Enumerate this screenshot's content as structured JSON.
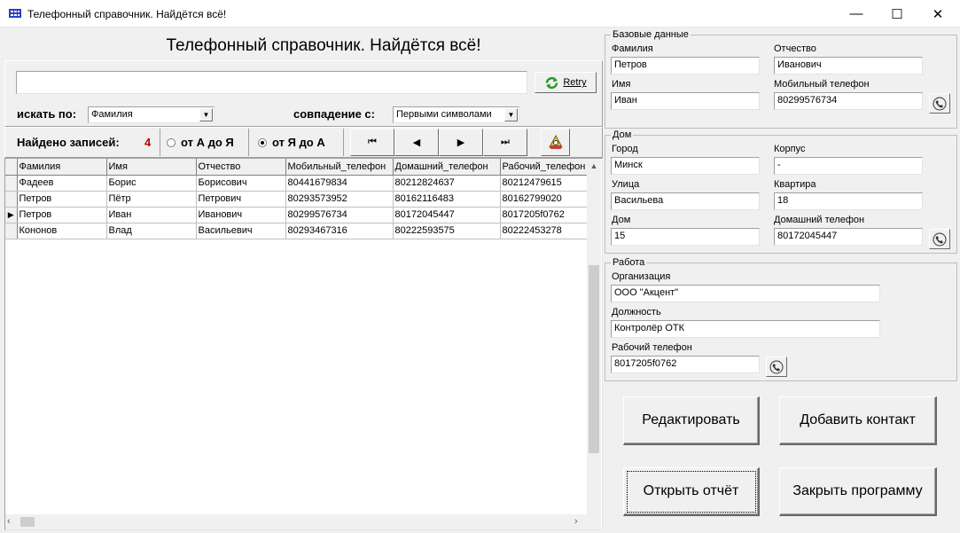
{
  "window": {
    "title": "Телефонный справочник. Найдётся всё!",
    "minimize": "—",
    "maximize": "☐",
    "close": "✕"
  },
  "header": {
    "title": "Телефонный справочник. Найдётся всё!"
  },
  "search": {
    "value": "",
    "retry_label": "Retry",
    "search_by_label": "искать по:",
    "search_by_value": "Фамилия",
    "match_label": "совпадение с:",
    "match_value": "Первыми символами"
  },
  "status": {
    "found_label": "Найдено записей:",
    "found_count": "4",
    "sort_asc_label": "от А до Я",
    "sort_desc_label": "от Я до А",
    "sort_selected": "desc"
  },
  "nav": {
    "first": "⏮",
    "prev": "◀",
    "next": "▶",
    "last": "⏭"
  },
  "grid": {
    "columns": [
      "Фамилия",
      "Имя",
      "Отчество",
      "Мобильный_телефон",
      "Домашний_телефон",
      "Рабочий_телефон"
    ],
    "rows": [
      [
        "Фадеев",
        "Борис",
        "Борисович",
        "80441679834",
        "80212824637",
        "80212479615"
      ],
      [
        "Петров",
        "Пётр",
        "Петрович",
        "80293573952",
        "80162116483",
        "80162799020"
      ],
      [
        "Петров",
        "Иван",
        "Иванович",
        "80299576734",
        "80172045447",
        "8017205f0762"
      ],
      [
        "Кононов",
        "Влад",
        "Васильевич",
        "80293467316",
        "80222593575",
        "80222453278"
      ]
    ],
    "current_row": 2
  },
  "basic": {
    "group_title": "Базовые данные",
    "last_name_label": "Фамилия",
    "last_name": "Петров",
    "patronymic_label": "Отчество",
    "patronymic": "Иванович",
    "first_name_label": "Имя",
    "first_name": "Иван",
    "mobile_label": "Мобильный телефон",
    "mobile": "80299576734"
  },
  "home": {
    "group_title": "Дом",
    "city_label": "Город",
    "city": "Минск",
    "building_label": "Корпус",
    "building": "-",
    "street_label": "Улица",
    "street": "Васильева",
    "apartment_label": "Квартира",
    "apartment": "18",
    "house_label": "Дом",
    "house": "15",
    "home_phone_label": "Домашний телефон",
    "home_phone": "80172045447"
  },
  "work": {
    "group_title": "Работа",
    "org_label": "Организация",
    "org": "ООО \"Акцент\"",
    "position_label": "Должность",
    "position": "Контролёр ОТК",
    "work_phone_label": "Рабочий телефон",
    "work_phone": "8017205f0762"
  },
  "actions": {
    "edit": "Редактировать",
    "add": "Добавить контакт",
    "report": "Открыть отчёт",
    "exit": "Закрыть программу"
  },
  "colors": {
    "count_red": "#c00000",
    "grid_border": "#c0c0c0",
    "retry_green": "#2a9a2a"
  }
}
